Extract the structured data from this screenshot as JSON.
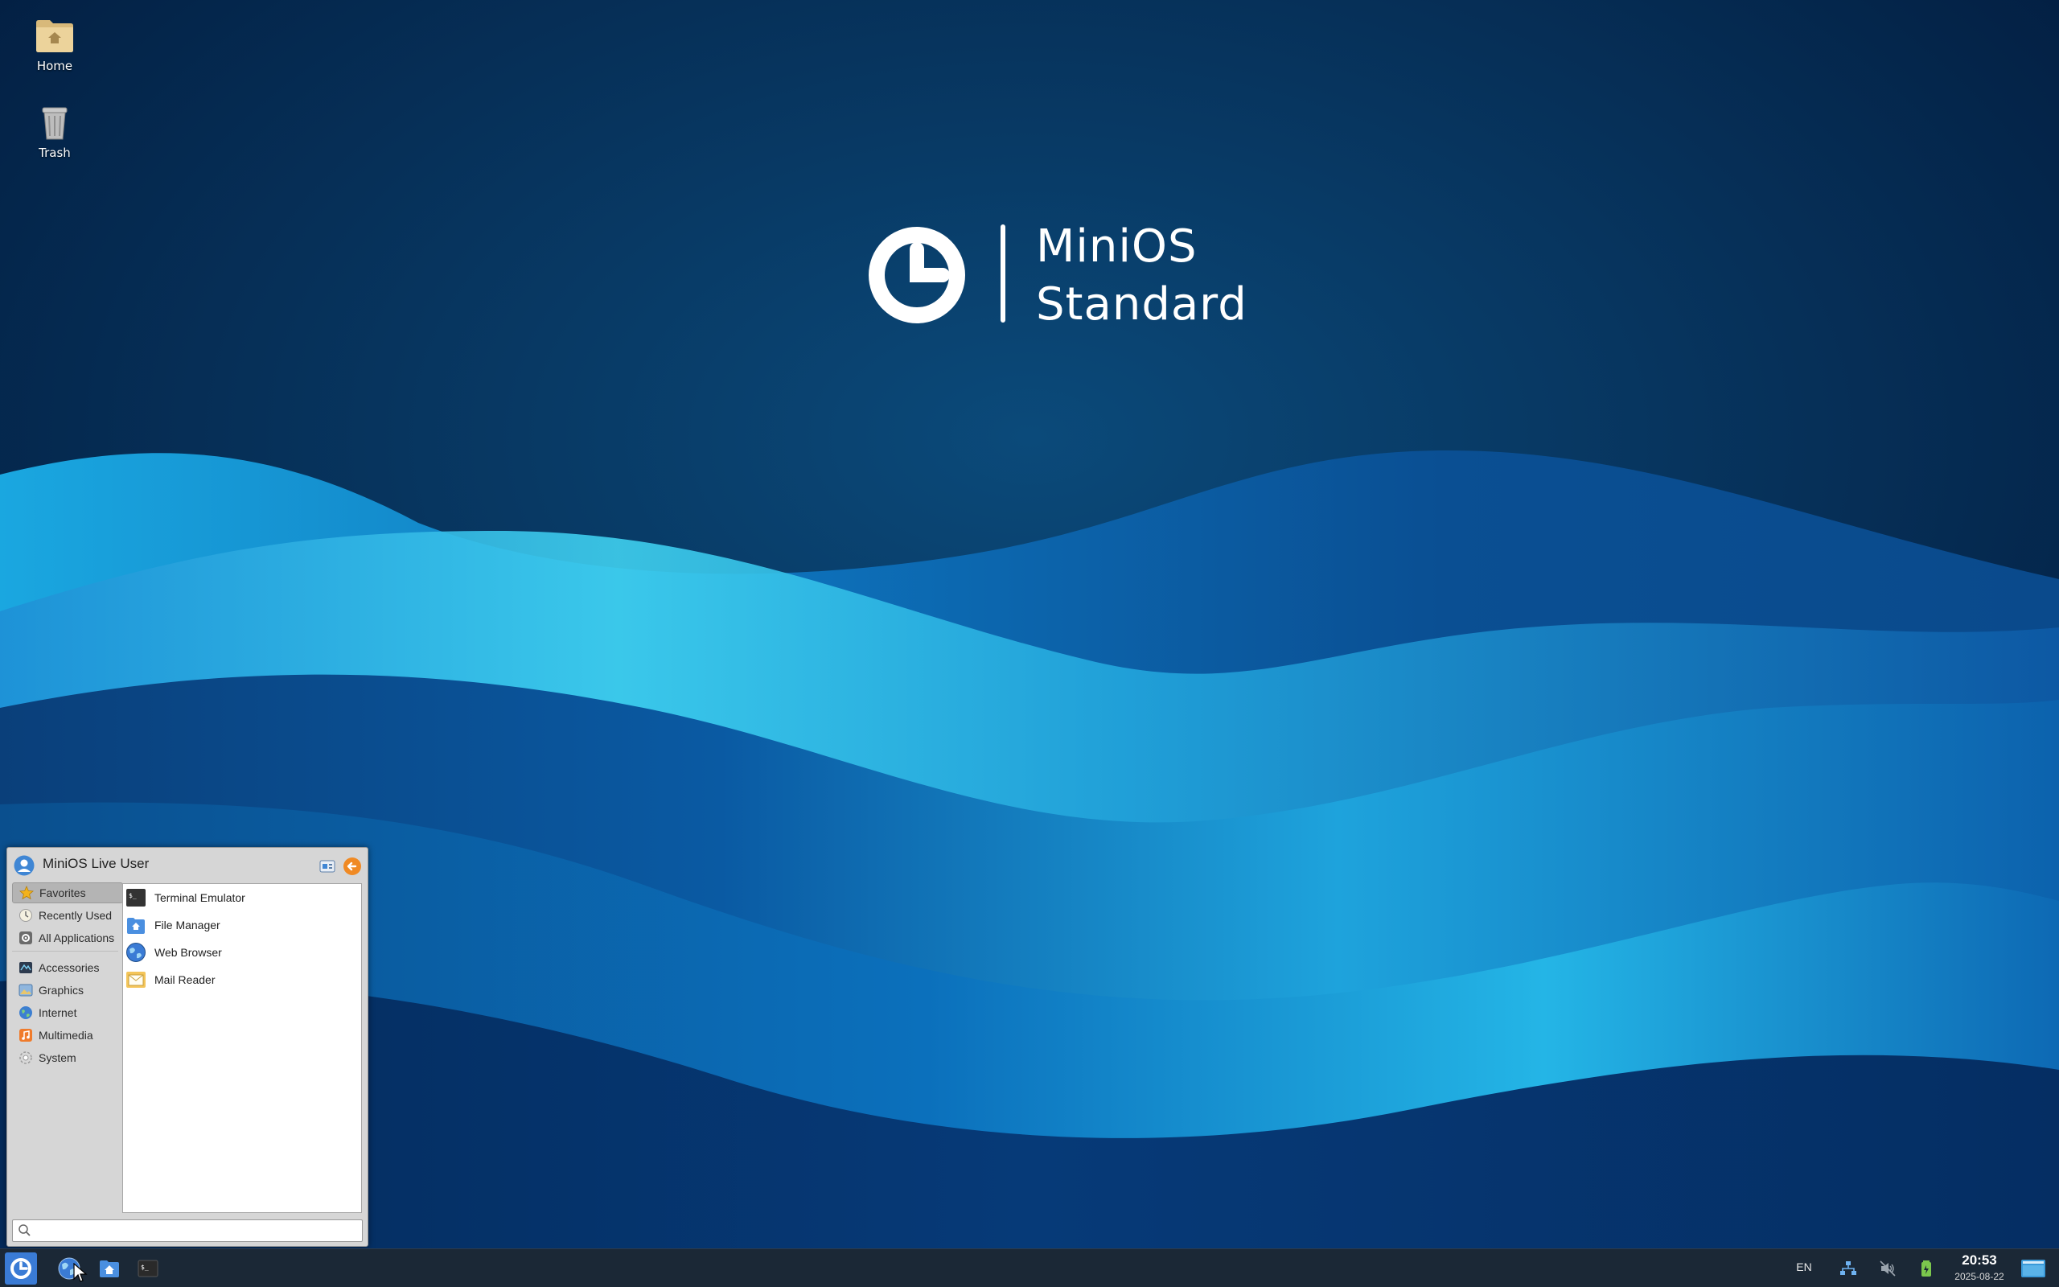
{
  "wallpaper": {
    "brand": {
      "line1": "MiniOS",
      "line2": "Standard"
    }
  },
  "desktop_icons": [
    {
      "label": "Home",
      "icon": "home-folder-icon"
    },
    {
      "label": "Trash",
      "icon": "trash-icon"
    }
  ],
  "menu": {
    "username": "MiniOS Live User",
    "categories": [
      {
        "label": "Favorites",
        "icon": "star-icon",
        "selected": true
      },
      {
        "label": "Recently Used",
        "icon": "clock-icon",
        "selected": false
      },
      {
        "label": "All Applications",
        "icon": "apps-gear-icon",
        "selected": false
      },
      {
        "label": "Accessories",
        "icon": "accessories-icon",
        "selected": false
      },
      {
        "label": "Graphics",
        "icon": "graphics-icon",
        "selected": false
      },
      {
        "label": "Internet",
        "icon": "globe-icon",
        "selected": false
      },
      {
        "label": "Multimedia",
        "icon": "music-note-icon",
        "selected": false
      },
      {
        "label": "System",
        "icon": "system-gear-icon",
        "selected": false
      }
    ],
    "apps": [
      {
        "label": "Terminal Emulator",
        "icon": "terminal-icon"
      },
      {
        "label": "File Manager",
        "icon": "file-manager-icon"
      },
      {
        "label": "Web Browser",
        "icon": "web-browser-icon"
      },
      {
        "label": "Mail Reader",
        "icon": "mail-icon"
      }
    ],
    "search": {
      "value": "",
      "placeholder": ""
    }
  },
  "taskbar": {
    "language": "EN",
    "time": "20:53",
    "date": "2025-08-22",
    "colors": {
      "background": "#1b2836",
      "menu_button": "#3a7bd5"
    }
  }
}
